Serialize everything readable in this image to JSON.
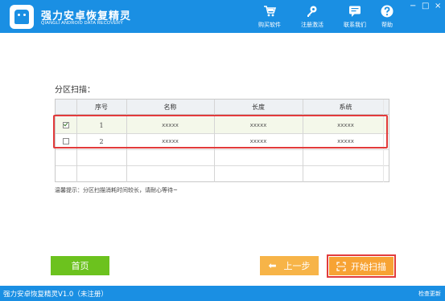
{
  "header": {
    "app_name": "强力安卓恢复精灵",
    "app_subtitle": "QIANGLI ANDROID DATA RECOVERY",
    "buttons": [
      {
        "label": "购买软件",
        "icon": "cart-icon"
      },
      {
        "label": "注册激活",
        "icon": "key-icon"
      },
      {
        "label": "联系我们",
        "icon": "chat-icon"
      },
      {
        "label": "帮助",
        "icon": "help-icon"
      }
    ],
    "window_controls": {
      "minimize": "−",
      "restore": "□",
      "close": "×"
    }
  },
  "section": {
    "label": "分区扫描："
  },
  "table": {
    "columns": [
      "序号",
      "名称",
      "长度",
      "系统"
    ],
    "rows": [
      {
        "checked": true,
        "index": "1",
        "name": "xxxxx",
        "length": "xxxxx",
        "system": "xxxxx"
      },
      {
        "checked": false,
        "index": "2",
        "name": "xxxxx",
        "length": "xxxxx",
        "system": "xxxxx"
      }
    ]
  },
  "tip": "温馨提示：分区扫描消耗时间较长，请耐心等待~",
  "buttons": {
    "home": "首页",
    "prev": "上一步",
    "scan": "开始扫描"
  },
  "status": {
    "left": "强力安卓恢复精灵V1.0（未注册）",
    "right": "检查更新"
  },
  "colors": {
    "brand_blue": "#1a8fe3",
    "home_green": "#6cc21e",
    "prev_orange": "#f7b448",
    "scan_orange": "#f7a334",
    "highlight_red": "#e23b3b"
  }
}
